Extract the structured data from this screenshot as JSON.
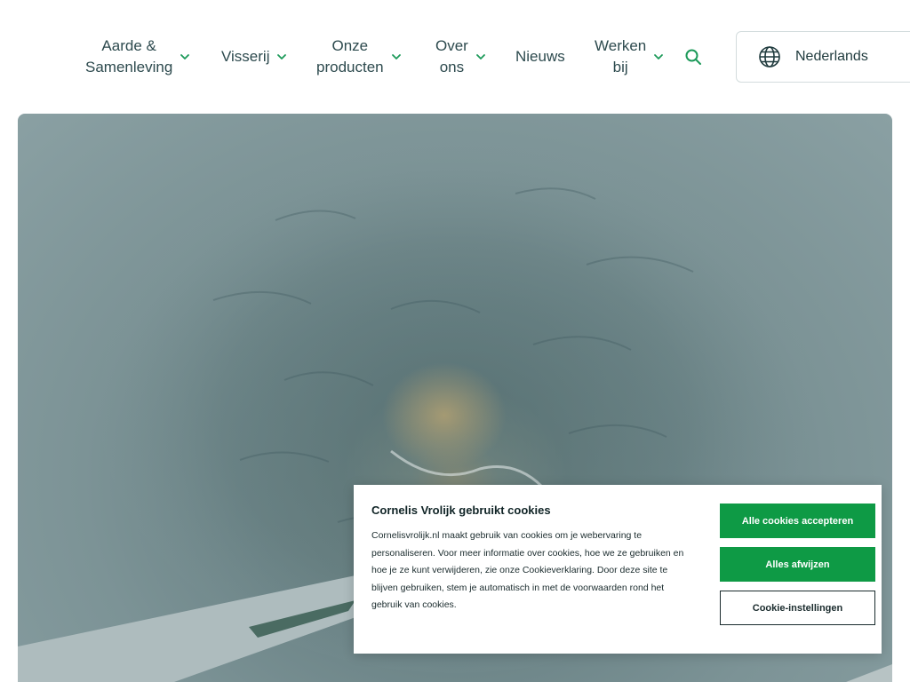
{
  "nav": {
    "items": [
      {
        "label": "Aarde & Samenleving",
        "line1": "Aarde &",
        "line2": "Samenleving",
        "has_dropdown": true
      },
      {
        "label": "Visserij",
        "has_dropdown": true
      },
      {
        "label": "Onze producten",
        "line1": "Onze",
        "line2": "producten",
        "has_dropdown": true
      },
      {
        "label": "Over ons",
        "line1": "Over",
        "line2": "ons",
        "has_dropdown": true
      },
      {
        "label": "Nieuws",
        "has_dropdown": false
      },
      {
        "label": "Werken bij",
        "line1": "Werken",
        "line2": "bij",
        "has_dropdown": true
      }
    ],
    "search_icon": "search-icon",
    "language": {
      "label": "Nederlands",
      "icon": "globe-icon"
    }
  },
  "colors": {
    "accent": "#0e9a45",
    "nav_text": "#2d4a4e",
    "chevron": "#1d9a5a",
    "dark_text": "#1a2b2d"
  },
  "cookie": {
    "title": "Cornelis Vrolijk gebruikt cookies",
    "body": "Cornelisvrolijk.nl maakt gebruik van cookies om je webervaring te personaliseren. Voor meer informatie over cookies, hoe we ze gebruiken en hoe je ze kunt verwijderen, zie onze Cookieverklaring. Door deze site te blijven gebruiken, stem je automatisch in met de voorwaarden rond het gebruik van cookies.",
    "accept_all": "Alle cookies accepteren",
    "reject_all": "Alles afwijzen",
    "settings": "Cookie-instellingen"
  }
}
